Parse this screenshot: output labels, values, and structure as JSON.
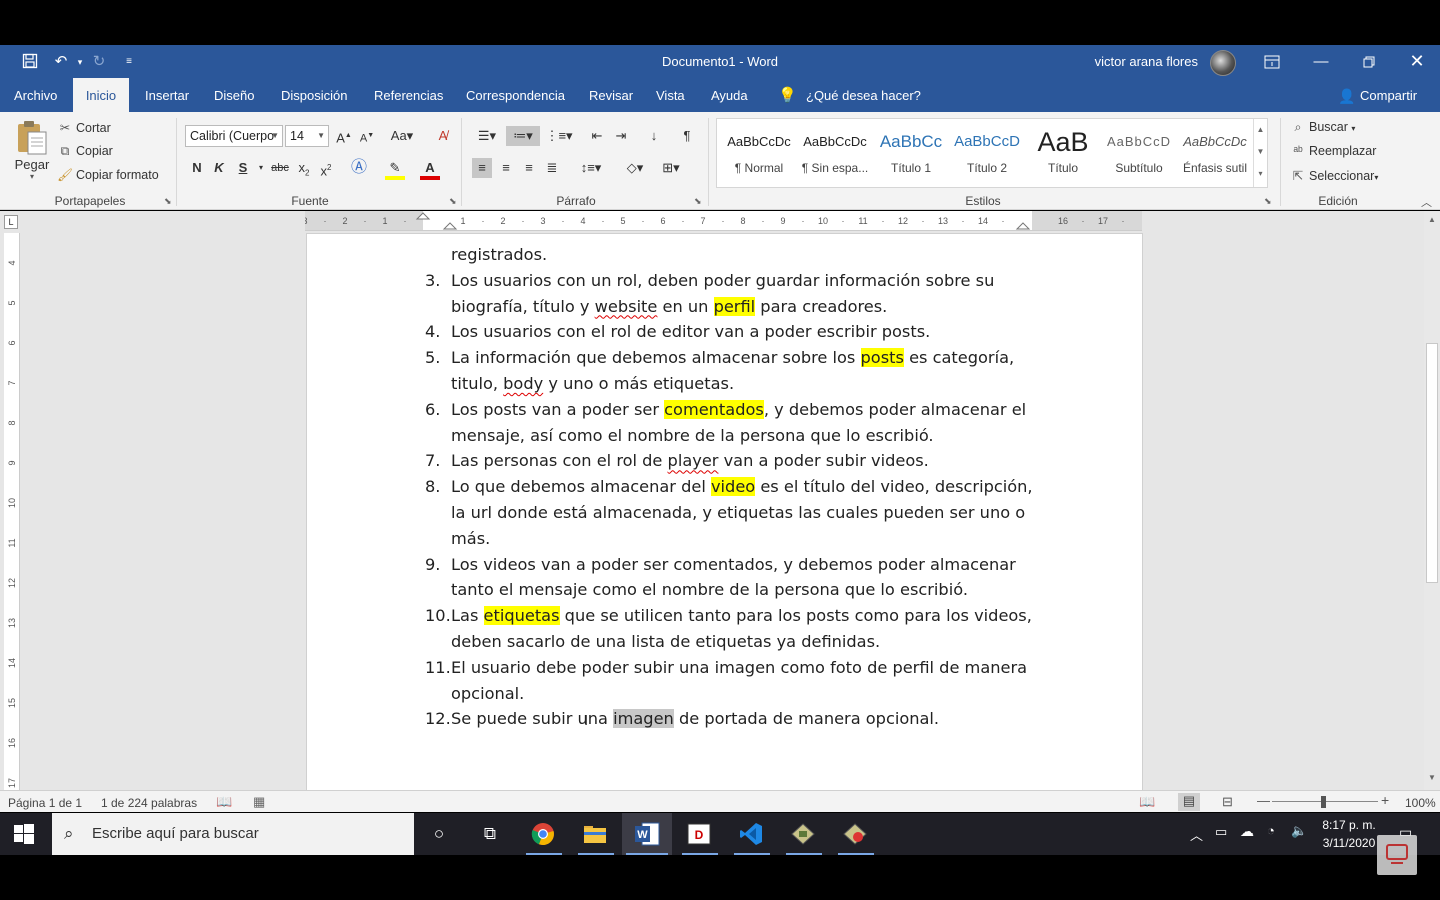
{
  "window": {
    "title": "Documento1  -  Word",
    "user": "victor arana flores"
  },
  "menu_tabs": [
    "Archivo",
    "Inicio",
    "Insertar",
    "Diseño",
    "Disposición",
    "Referencias",
    "Correspondencia",
    "Revisar",
    "Vista",
    "Ayuda"
  ],
  "active_tab": "Inicio",
  "tell_me": "¿Qué desea hacer?",
  "share": "Compartir",
  "clipboard": {
    "paste": "Pegar",
    "cut": "Cortar",
    "copy": "Copiar",
    "format_painter": "Copiar formato",
    "group": "Portapapeles"
  },
  "font": {
    "name": "Calibri (Cuerpo",
    "size": "14",
    "group": "Fuente"
  },
  "paragraph": {
    "group": "Párrafo"
  },
  "styles": {
    "group": "Estilos",
    "items": [
      {
        "preview": "AaBbCcDc",
        "name": "¶ Normal"
      },
      {
        "preview": "AaBbCcDc",
        "name": "¶ Sin espa..."
      },
      {
        "preview": "AaBbCc",
        "name": "Título 1"
      },
      {
        "preview": "AaBbCcD",
        "name": "Título 2"
      },
      {
        "preview": "AaB",
        "name": "Título"
      },
      {
        "preview": "AaBbCcD",
        "name": "Subtítulo"
      },
      {
        "preview": "AaBbCcDc",
        "name": "Énfasis sutil"
      }
    ]
  },
  "editing": {
    "find": "Buscar",
    "replace": "Reemplazar",
    "select": "Seleccionar",
    "group": "Edición"
  },
  "document": {
    "items": [
      {
        "num": "",
        "segments": [
          {
            "t": "registrados."
          }
        ]
      },
      {
        "num": "3.",
        "segments": [
          {
            "t": "Los usuarios con un rol, deben poder guardar información sobre su biografía, título y "
          },
          {
            "t": "website",
            "s": "spell"
          },
          {
            "t": " en un "
          },
          {
            "t": "perfil",
            "s": "hl"
          },
          {
            "t": " para creadores."
          }
        ]
      },
      {
        "num": "4.",
        "segments": [
          {
            "t": "Los usuarios con el rol de editor van a poder escribir posts."
          }
        ]
      },
      {
        "num": "5.",
        "segments": [
          {
            "t": "La información que debemos almacenar sobre los "
          },
          {
            "t": "posts",
            "s": "hl"
          },
          {
            "t": " es categoría, titulo, "
          },
          {
            "t": "body",
            "s": "spell"
          },
          {
            "t": " y uno o más etiquetas."
          }
        ]
      },
      {
        "num": "6.",
        "segments": [
          {
            "t": "Los posts van a poder ser "
          },
          {
            "t": "comentados",
            "s": "hl"
          },
          {
            "t": ", y debemos poder almacenar el mensaje, así como el nombre de la persona que lo escribió."
          }
        ]
      },
      {
        "num": "7.",
        "segments": [
          {
            "t": "Las personas con el rol de "
          },
          {
            "t": "player",
            "s": "spell"
          },
          {
            "t": " van a poder subir videos."
          }
        ]
      },
      {
        "num": "8.",
        "segments": [
          {
            "t": "Lo que debemos almacenar del "
          },
          {
            "t": "video",
            "s": "hl"
          },
          {
            "t": " es el título del video, descripción, la url donde está almacenada, y etiquetas las cuales pueden ser uno o más."
          }
        ]
      },
      {
        "num": "9.",
        "segments": [
          {
            "t": "Los videos van a poder ser comentados, y debemos poder almacenar tanto el mensaje como el nombre de la persona que lo escribió."
          }
        ]
      },
      {
        "num": "10.",
        "segments": [
          {
            "t": "Las "
          },
          {
            "t": "etiquetas",
            "s": "hl"
          },
          {
            "t": " que se utilicen tanto para los posts como para los videos, deben sacarlo de una lista de etiquetas ya definidas."
          }
        ]
      },
      {
        "num": "11.",
        "segments": [
          {
            "t": "El usuario debe poder subir una imagen como foto de perfil de manera opcional."
          }
        ]
      },
      {
        "num": "12.",
        "segments": [
          {
            "t": "Se puede subir una "
          },
          {
            "t": "imagen",
            "s": "sel"
          },
          {
            "t": " de portada de manera opcional."
          }
        ]
      }
    ]
  },
  "status": {
    "page": "Página 1 de 1",
    "words": "1 de 224 palabras",
    "zoom": "100%"
  },
  "taskbar": {
    "search_placeholder": "Escribe aquí para buscar",
    "time": "8:17 p. m.",
    "date": "3/11/2020"
  },
  "colors": {
    "word_blue": "#2b579a",
    "highlight": "#ffff00"
  }
}
